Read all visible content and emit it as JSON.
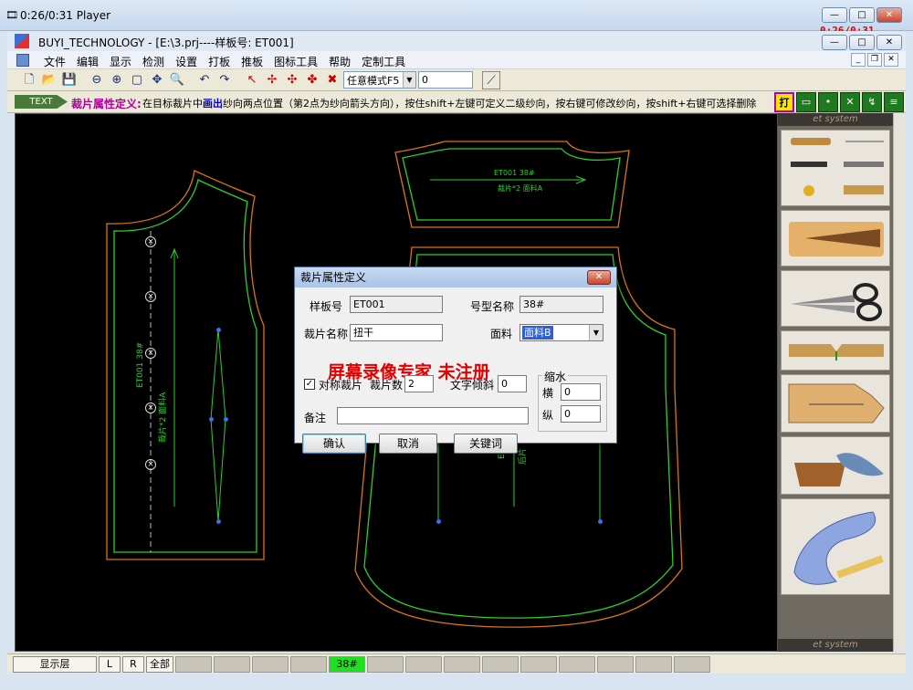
{
  "player": {
    "title": "0:26/0:31 Player",
    "timer": "0:26/0:31"
  },
  "app": {
    "title": "BUYI_TECHNOLOGY - [E:\\3.prj----样板号: ET001]",
    "menus": [
      "文件",
      "编辑",
      "显示",
      "检测",
      "设置",
      "打板",
      "推板",
      "图标工具",
      "帮助",
      "定制工具"
    ]
  },
  "toolbar": {
    "mode_select": "任意模式F5",
    "value_input": "0"
  },
  "hint": {
    "badge": "TEXT",
    "title": "裁片属性定义:",
    "text_before": "在目标裁片中",
    "text_highlight": "画出",
    "text_after": "纱向两点位置（第2点为纱向箭头方向），按住shift+左键可定义二级纱向，按右键可修改纱向，按shift+右键可选择删除",
    "right_tool_active": "打"
  },
  "pattern_labels": {
    "back_top_1": "ET001 38#",
    "back_top_2": "裁片*2 面料A",
    "left_piece_1": "ET001 38#",
    "left_piece_2": "裁片*2 面料A",
    "back_body_1": "ET",
    "back_body_2": "后片"
  },
  "palette": {
    "header": "et system",
    "footer": "et system"
  },
  "statusbar": {
    "layer_button": "显示层",
    "l_button": "L",
    "r_button": "R",
    "all_button": "全部",
    "size_tag": "38#"
  },
  "dialog": {
    "title": "裁片属性定义",
    "pattern_no_label": "样板号",
    "pattern_no": "ET001",
    "size_name_label": "号型名称",
    "size_name": "38#",
    "piece_name_label": "裁片名称",
    "piece_name": "扭干",
    "fabric_label": "面料",
    "fabric_value": "面料B",
    "symmetric_label": "对称裁片",
    "piece_count_label": "裁片数",
    "piece_count": "2",
    "text_angle_label": "文字倾斜",
    "text_angle": "0",
    "shrink_group_label": "缩水",
    "horizontal_label": "横",
    "horizontal_value": "0",
    "vertical_label": "纵",
    "vertical_value": "0",
    "remark_label": "备注",
    "remark": "",
    "ok_button": "确认",
    "cancel_button": "取消",
    "keyword_button": "关键词",
    "watermark": "屏幕录像专家  未注册"
  }
}
